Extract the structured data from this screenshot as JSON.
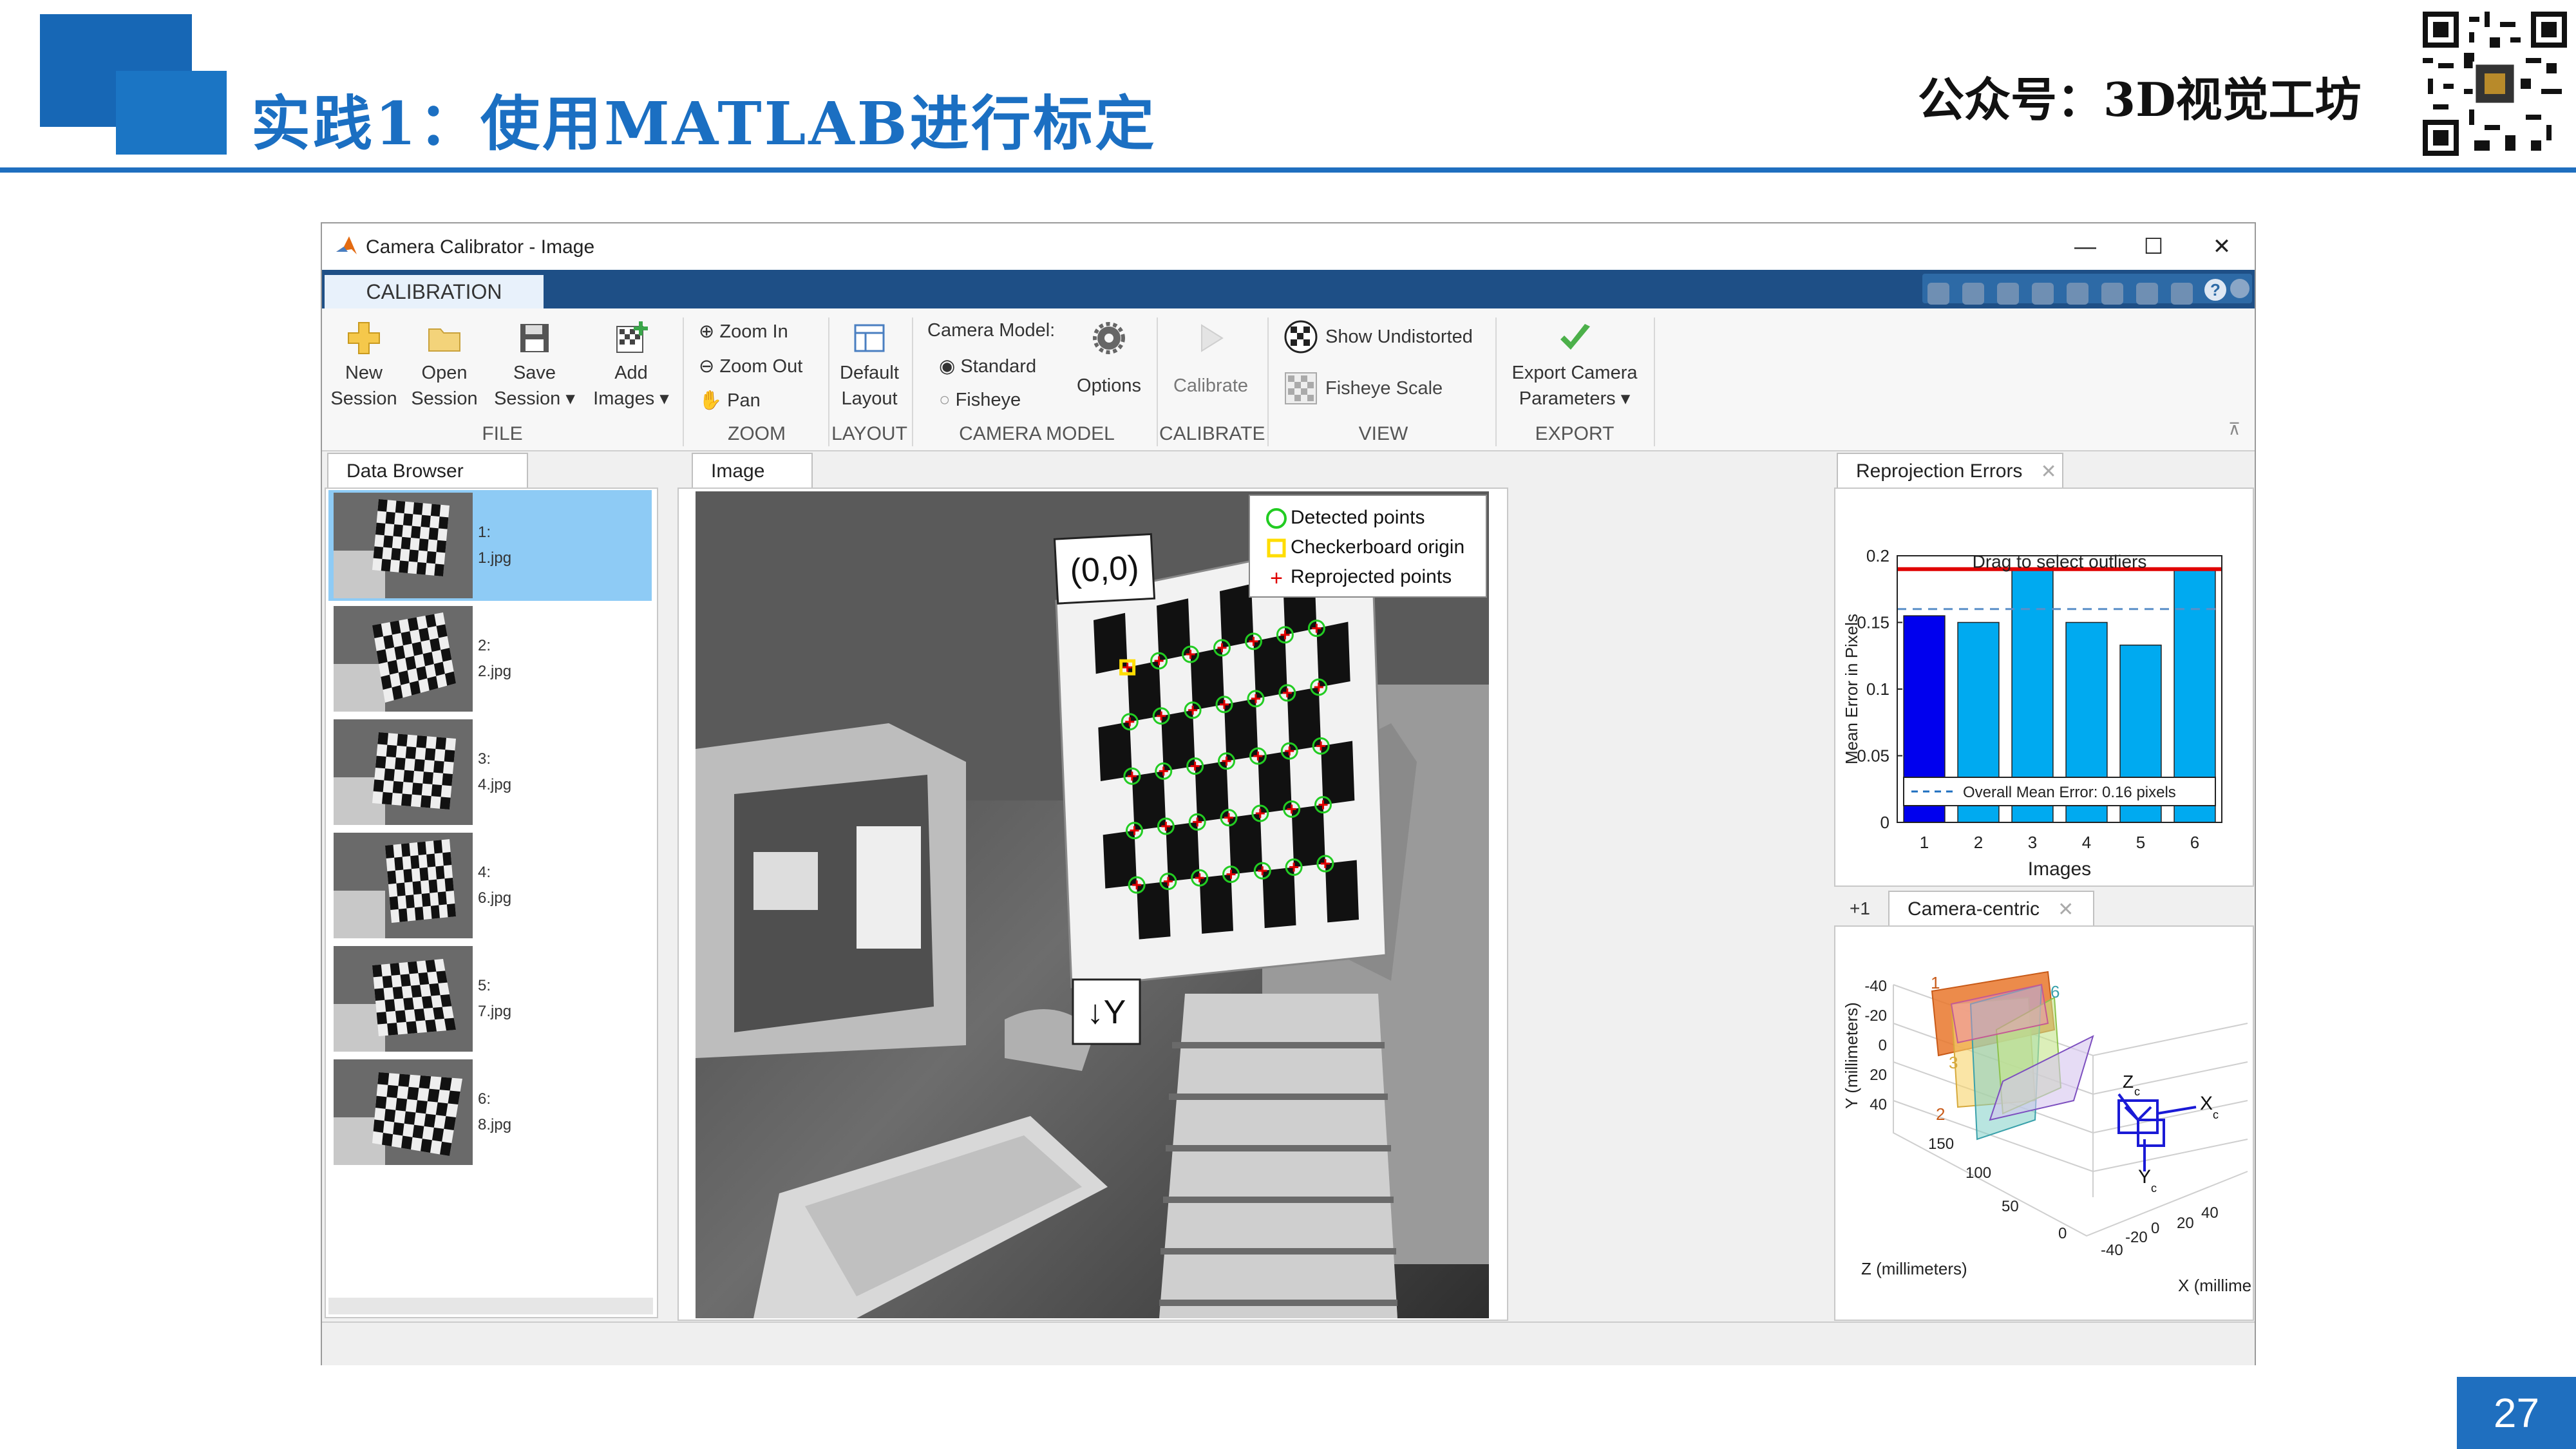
{
  "slide": {
    "title": "实践1：使用MATLAB进行标定",
    "brand": "公众号：3D视觉工坊",
    "page_number": "27"
  },
  "window": {
    "title": "Camera Calibrator - Image",
    "controls": [
      "—",
      "☐",
      "✕"
    ]
  },
  "ribbon": {
    "tab": "CALIBRATION",
    "file": {
      "new_session": [
        "New",
        "Session"
      ],
      "open_session": [
        "Open",
        "Session"
      ],
      "save_session": [
        "Save",
        "Session ▾"
      ],
      "add_images": [
        "Add",
        "Images ▾"
      ],
      "label": "FILE"
    },
    "zoom": {
      "zoom_in": "Zoom In",
      "zoom_out": "Zoom Out",
      "pan": "Pan",
      "label": "ZOOM"
    },
    "layout": {
      "default_layout": [
        "Default",
        "Layout"
      ],
      "label": "LAYOUT"
    },
    "camera_model": {
      "title": "Camera Model:",
      "standard": "Standard",
      "fisheye": "Fisheye",
      "options": "Options",
      "label": "CAMERA MODEL"
    },
    "calibrate": {
      "button": "Calibrate",
      "label": "CALIBRATE"
    },
    "view": {
      "show_undistorted": "Show Undistorted",
      "fisheye_scale": "Fisheye Scale",
      "label": "VIEW"
    },
    "export": {
      "button": [
        "Export Camera",
        "Parameters ▾"
      ],
      "label": "EXPORT"
    }
  },
  "data_browser": {
    "tab": "Data Browser",
    "images": [
      {
        "index": "1:",
        "file": "1.jpg"
      },
      {
        "index": "2:",
        "file": "2.jpg"
      },
      {
        "index": "3:",
        "file": "4.jpg"
      },
      {
        "index": "4:",
        "file": "6.jpg"
      },
      {
        "index": "5:",
        "file": "7.jpg"
      },
      {
        "index": "6:",
        "file": "8.jpg"
      }
    ],
    "selected_index": 0
  },
  "image_panel": {
    "tab": "Image",
    "origin_label": "(0,0)",
    "y_axis_label": "↓Y",
    "legend": [
      "Detected points",
      "Checkerboard origin",
      "Reprojected points"
    ]
  },
  "reprojection_errors": {
    "tab": "Reprojection Errors",
    "drag_label": "Drag to select outliers",
    "mean_error_label": "Overall Mean Error: 0.16 pixels",
    "colors": {
      "selected": "#0000ee",
      "bars": "#00aaf0",
      "limit": "#e00000",
      "mean": "#1f6fbf"
    }
  },
  "chart_data": {
    "type": "bar",
    "categories": [
      "1",
      "2",
      "3",
      "4",
      "5",
      "6"
    ],
    "values": [
      0.155,
      0.15,
      0.19,
      0.15,
      0.133,
      0.19
    ],
    "xlabel": "Images",
    "ylabel": "Mean Error in Pixels",
    "ylim": [
      0,
      0.2
    ],
    "yticks": [
      "0",
      "0.05",
      "0.1",
      "0.15",
      "0.2"
    ],
    "mean": 0.16,
    "limit": 0.19,
    "grid": false
  },
  "camera_centric": {
    "tab_prefix": "+1",
    "tab": "Camera-centric",
    "ylabel": "Y (millimeters)",
    "zlabel": "Z (millimeters)",
    "xlabel": "X (millime",
    "y_ticks": [
      "-40",
      "-20",
      "0",
      "20",
      "40"
    ],
    "z_ticks": [
      "150",
      "100",
      "50",
      "0"
    ],
    "x_ticks": [
      "-40",
      "-20",
      "0",
      "20",
      "40"
    ],
    "axis_x": "X",
    "axis_y": "Y",
    "axis_z": "Z",
    "axis_sub": "c",
    "plane_numbers": [
      "1",
      "2",
      "3",
      "6"
    ]
  }
}
